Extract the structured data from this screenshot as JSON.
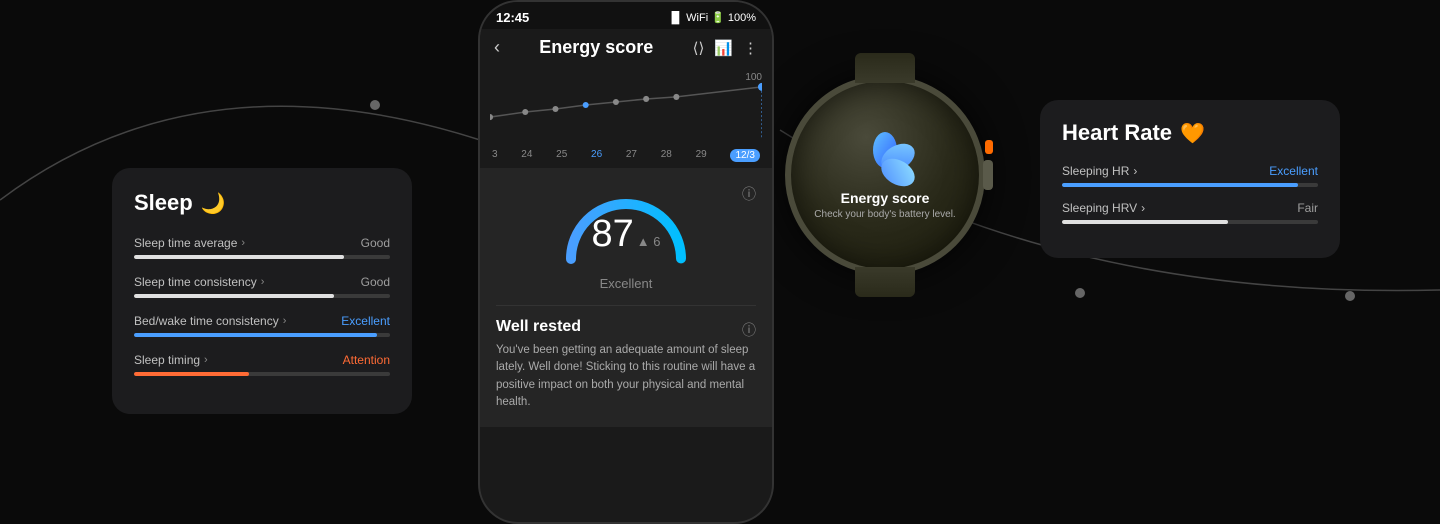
{
  "background": {
    "color": "#0a0a0a"
  },
  "sleep_card": {
    "title": "Sleep",
    "title_icon": "🌙",
    "metrics": [
      {
        "label": "Sleep time average",
        "value": "Good",
        "value_type": "good",
        "fill": "fill-good"
      },
      {
        "label": "Sleep time consistency",
        "value": "Good",
        "value_type": "good",
        "fill": "fill-good2"
      },
      {
        "label": "Bed/wake time consistency",
        "value": "Excellent",
        "value_type": "excellent",
        "fill": "fill-excellent"
      },
      {
        "label": "Sleep timing",
        "value": "Attention",
        "value_type": "attention",
        "fill": "fill-attention"
      }
    ]
  },
  "phone": {
    "status_time": "12:45",
    "status_battery": "100%",
    "header_title": "Energy score",
    "chart": {
      "max_label": "100",
      "dates": [
        "3",
        "24",
        "25",
        "26",
        "27",
        "28",
        "29",
        "12/3"
      ],
      "active_date": "12/3"
    },
    "score": {
      "value": "87",
      "delta": "▲ 6",
      "label": "Excellent"
    },
    "well_rested": {
      "title": "Well rested",
      "text": "You've been getting an adequate amount of sleep lately. Well done! Sticking to this routine will have a positive impact on both your physical and mental health."
    }
  },
  "watch": {
    "title": "Energy score",
    "subtitle": "Check your body's battery level.",
    "flower_icon": "🌸"
  },
  "heartrate_card": {
    "title": "Heart Rate",
    "heart_icon": "🧡",
    "metrics": [
      {
        "label": "Sleeping HR",
        "value": "Excellent",
        "value_type": "excellent",
        "fill": "hr-fill-excellent"
      },
      {
        "label": "Sleeping HRV",
        "value": "Fair",
        "value_type": "fair",
        "fill": "hr-fill-fair"
      }
    ]
  }
}
